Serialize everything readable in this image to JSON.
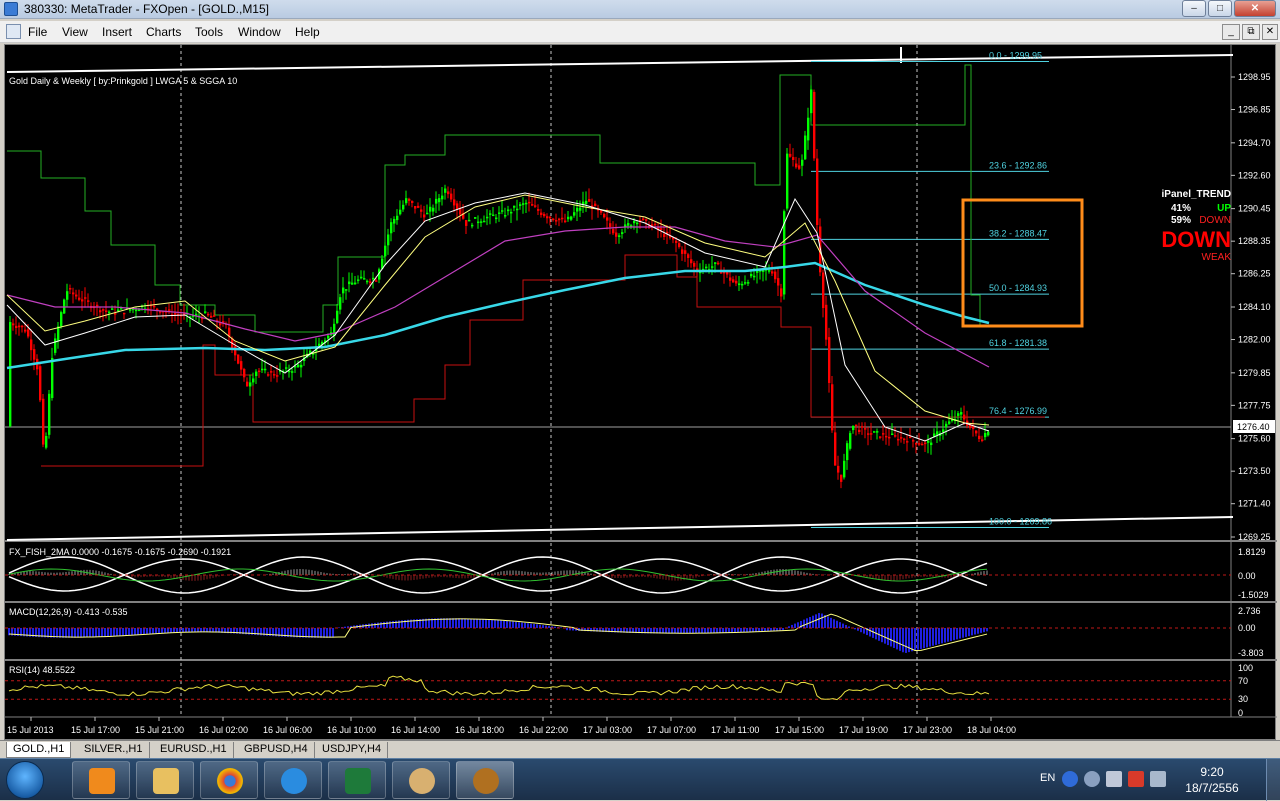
{
  "window": {
    "title": "380330: MetaTrader - FXOpen - [GOLD.,M15]",
    "buttons": [
      "–",
      "□",
      "✕"
    ]
  },
  "menu": [
    "File",
    "View",
    "Insert",
    "Charts",
    "Tools",
    "Window",
    "Help"
  ],
  "mdi_buttons": [
    "_",
    "⧉",
    "✕"
  ],
  "chart": {
    "main_label": "Gold Daily & Weekly [ by:Prinkgold ]  LWGA 5  &  SGGA 10",
    "price_axis": [
      "1298.95",
      "1296.85",
      "1294.70",
      "1292.60",
      "1290.45",
      "1288.35",
      "1286.25",
      "1284.10",
      "1282.00",
      "1279.85",
      "1277.75",
      "1275.60",
      "1273.50",
      "1271.40",
      "1269.25"
    ],
    "current_price": "1276.40",
    "fib_levels": [
      {
        "label": "0.0 - 1299.95",
        "price": 1299.95
      },
      {
        "label": "23.6 - 1292.86",
        "price": 1292.86
      },
      {
        "label": "38.2 - 1288.47",
        "price": 1288.47
      },
      {
        "label": "50.0 - 1284.93",
        "price": 1284.93
      },
      {
        "label": "61.8 - 1281.38",
        "price": 1281.38
      },
      {
        "label": "76.4 - 1276.99",
        "price": 1276.99
      },
      {
        "label": "100.0 - 1269.86",
        "price": 1269.86
      }
    ],
    "time_axis": [
      "15 Jul 2013",
      "15 Jul 17:00",
      "15 Jul 21:00",
      "16 Jul 02:00",
      "16 Jul 06:00",
      "16 Jul 10:00",
      "16 Jul 14:00",
      "16 Jul 18:00",
      "16 Jul 22:00",
      "17 Jul 03:00",
      "17 Jul 07:00",
      "17 Jul 11:00",
      "17 Jul 15:00",
      "17 Jul 19:00",
      "17 Jul 23:00",
      "18 Jul 04:00"
    ],
    "ipanel": {
      "title": "iPanel_TREND",
      "up_pct": "41%",
      "up_label": "UP",
      "down_pct": "59%",
      "down_label": "DOWN",
      "signal": "DOWN",
      "strength": "WEAK"
    },
    "fisher": {
      "label": "FX_FISH_2MA 0.0000 -0.1675 -0.1675 -0.2690 -0.1921",
      "axis": [
        "1.8129",
        "0.00",
        "-1.5029"
      ]
    },
    "macd": {
      "label": "MACD(12,26,9) -0.413 -0.535",
      "axis": [
        "2.736",
        "0.00",
        "-3.803"
      ]
    },
    "rsi": {
      "label": "RSI(14) 48.5522",
      "axis": [
        "100",
        "70",
        "30",
        "0"
      ]
    },
    "colors": {
      "bull": "#00ff00",
      "bear": "#ff0000",
      "fib": "#4fd2e0",
      "ma_slow": "#38d8e8",
      "ma_mid": "#c040c0",
      "ma_fast": "#ffff80",
      "highlight_box": "#ff8c1a"
    }
  },
  "tabs": [
    "GOLD.,H1",
    "SILVER.,H1",
    "EURUSD.,H1",
    "GBPUSD,H4",
    "USDJPY,H4"
  ],
  "taskbar": {
    "lang": "EN",
    "time": "9:20",
    "date": "18/7/2556"
  }
}
